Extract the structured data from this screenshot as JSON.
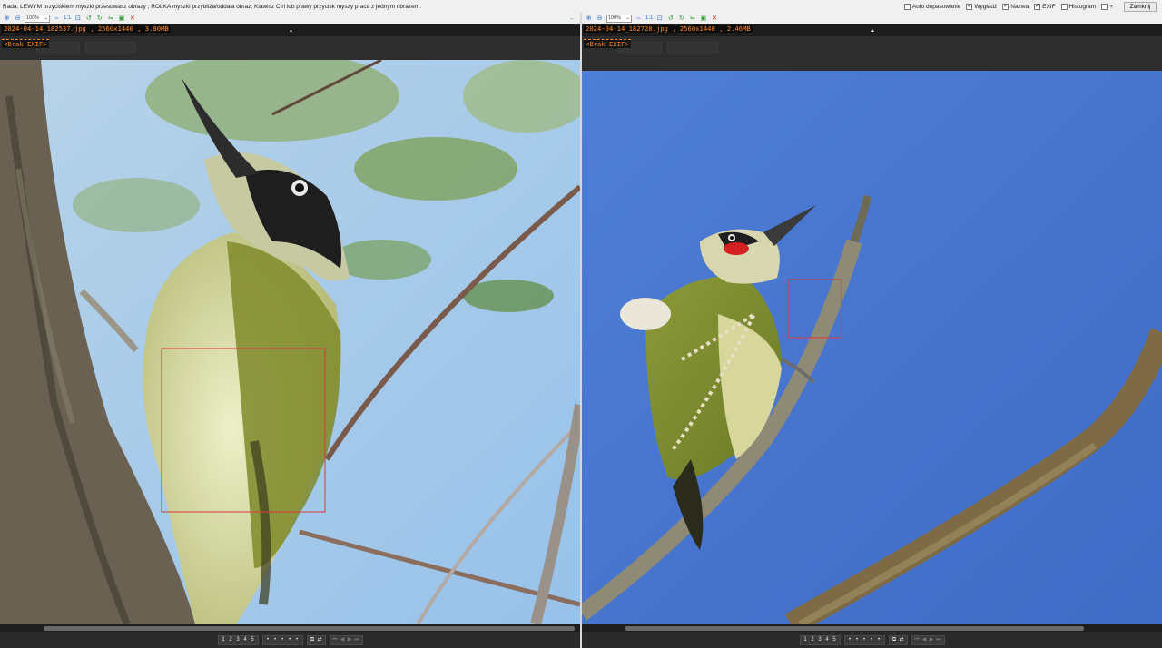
{
  "hint": "Rada: LEWYM przyciskiem myszki przesuwasz obrazy ; ROLKA myszki przybliża/oddala obraz; Klawisz Ctrl lub prawy przycisk myszy praca z jednym obrazem.",
  "options": [
    {
      "label": "Auto dopasowanie",
      "checked": false
    },
    {
      "label": "Wygładź",
      "checked": true
    },
    {
      "label": "Nazwa",
      "checked": true
    },
    {
      "label": "EXIF",
      "checked": true
    },
    {
      "label": "Histogram",
      "checked": false
    },
    {
      "label": "+",
      "checked": false
    }
  ],
  "close_label": "Zamknij",
  "left": {
    "zoom": "100%",
    "one_to_one": "1:1",
    "file_info": "2024-04-14_182537.jpg , 2560x1440 , 3.80MB",
    "exif": "<Brak EXIF>"
  },
  "right": {
    "zoom": "100%",
    "one_to_one": "1:1",
    "file_info": "2024-04-14_182720.jpg , 2560x1440 , 2.46MB",
    "exif": "<Brak EXIF>"
  },
  "bottom_buttons": {
    "views": [
      "1",
      "2",
      "3",
      "4",
      "5"
    ],
    "dots": [
      "•",
      "•",
      "•",
      "•",
      "•"
    ]
  },
  "colors": {
    "overlay_text": "#ff8a1e",
    "crop_box": "#d83a3a",
    "sky_right": "#4a77d0",
    "sky_left": "#a8cbe9"
  }
}
